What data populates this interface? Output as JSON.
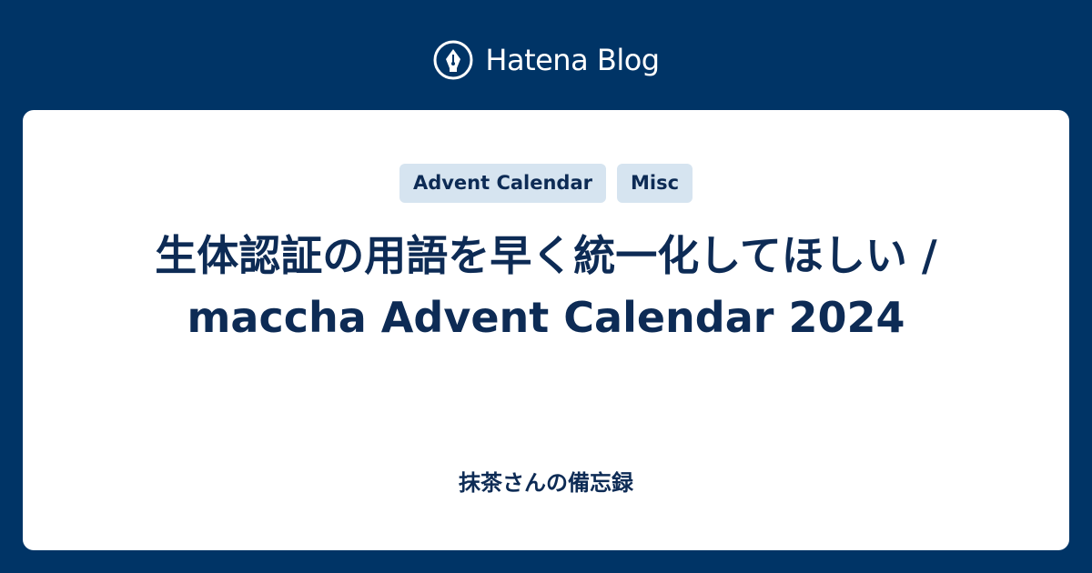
{
  "brand": {
    "logo_icon": "hatena-pen-nib-icon",
    "name": "Hatena Blog"
  },
  "card": {
    "tags": [
      "Advent Calendar",
      "Misc"
    ],
    "title": "生体認証の用語を早く統一化してほしい / maccha Advent Calendar 2024",
    "blog_name": "抹茶さんの備忘録"
  },
  "colors": {
    "background": "#003466",
    "card": "#ffffff",
    "tag_background": "#d6e4f0",
    "text": "#0d2b55"
  }
}
